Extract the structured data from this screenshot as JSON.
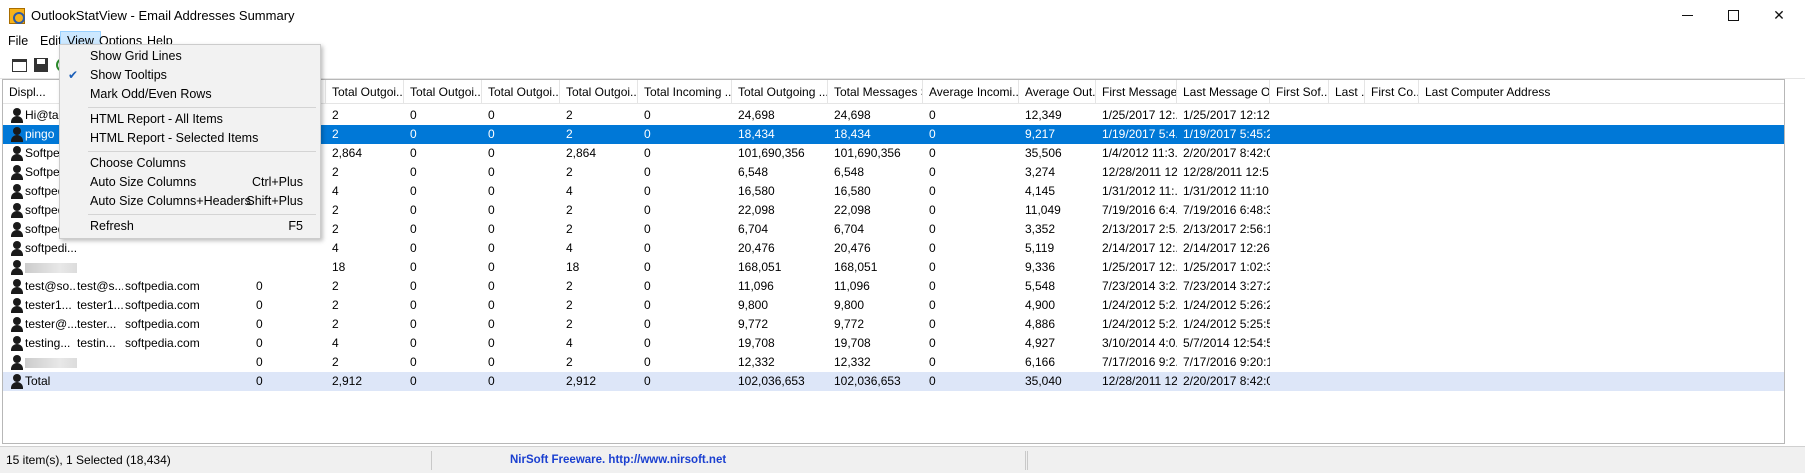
{
  "window": {
    "app_name": "OutlookStatView",
    "title_separator": "-",
    "subtitle": "Email Addresses Summary",
    "minimize": "—",
    "maximize": "□",
    "close": "✕"
  },
  "menu": {
    "file": "File",
    "edit": "Edit",
    "view": "View",
    "options": "Options",
    "help": "Help"
  },
  "view_menu": {
    "show_grid_lines": "Show Grid Lines",
    "show_tooltips": "Show Tooltips",
    "show_tooltips_checked": true,
    "mark_odd_even": "Mark Odd/Even Rows",
    "html_all": "HTML Report - All Items",
    "html_selected": "HTML Report - Selected Items",
    "choose_columns": "Choose Columns",
    "auto_size_columns": "Auto Size Columns",
    "auto_size_columns_shortcut": "Ctrl+Plus",
    "auto_size_headers": "Auto Size Columns+Headers",
    "auto_size_headers_shortcut": "Shift+Plus",
    "refresh": "Refresh",
    "refresh_shortcut": "F5"
  },
  "columns": [
    "Displ...",
    "Total Outgoi...",
    "Total Outgoi...",
    "Total Outgoi...",
    "Total Outgoi...",
    "Total Incoming ...",
    "Total Outgoing ...",
    "Total Messages S...",
    "Average Incomi...",
    "Average Out...",
    "First Message...",
    "Last Message On",
    "First Sof...",
    "Last ...",
    "First Co...",
    "Last Computer Address"
  ],
  "rows": [
    {
      "name": "Hi@tag...",
      "c2": "",
      "c3": "",
      "c4": "",
      "v": [
        "2",
        "0",
        "0",
        "2",
        "0",
        "24,698",
        "24,698",
        "0",
        "12,349",
        "1/25/2017 12:...",
        "1/25/2017 12:12:..."
      ]
    },
    {
      "name": "pingo",
      "c2": "",
      "c3": "",
      "c4": "",
      "v": [
        "2",
        "0",
        "0",
        "2",
        "0",
        "18,434",
        "18,434",
        "0",
        "9,217",
        "1/19/2017 5:4...",
        "1/19/2017 5:45:2..."
      ]
    },
    {
      "name": "Softpedi...",
      "c2": "",
      "c3": "",
      "c4": "",
      "v": [
        "2,864",
        "0",
        "0",
        "2,864",
        "0",
        "101,690,356",
        "101,690,356",
        "0",
        "35,506",
        "1/4/2012 11:3...",
        "2/20/2017 8:42:0..."
      ]
    },
    {
      "name": "Softpedi...",
      "c2": "",
      "c3": "",
      "c4": "",
      "v": [
        "2",
        "0",
        "0",
        "2",
        "0",
        "6,548",
        "6,548",
        "0",
        "3,274",
        "12/28/2011 12...",
        "12/28/2011 12:5..."
      ]
    },
    {
      "name": "softpedi...",
      "c2": "",
      "c3": "",
      "c4": "",
      "v": [
        "4",
        "0",
        "0",
        "4",
        "0",
        "16,580",
        "16,580",
        "0",
        "4,145",
        "1/31/2012 11:...",
        "1/31/2012 11:10:..."
      ]
    },
    {
      "name": "softpedi...",
      "c2": "",
      "c3": "",
      "c4": "",
      "v": [
        "2",
        "0",
        "0",
        "2",
        "0",
        "22,098",
        "22,098",
        "0",
        "11,049",
        "7/19/2016 6:4...",
        "7/19/2016 6:48:3..."
      ]
    },
    {
      "name": "softpedi...",
      "c2": "",
      "c3": "",
      "c4": "",
      "v": [
        "2",
        "0",
        "0",
        "2",
        "0",
        "6,704",
        "6,704",
        "0",
        "3,352",
        "2/13/2017 2:5...",
        "2/13/2017 2:56:1..."
      ]
    },
    {
      "name": "softpedi...",
      "c2": "",
      "c3": "",
      "c4": "",
      "v": [
        "4",
        "0",
        "0",
        "4",
        "0",
        "20,476",
        "20,476",
        "0",
        "5,119",
        "2/14/2017 12:...",
        "2/14/2017 12:26:..."
      ]
    },
    {
      "name": "",
      "blurred": true,
      "c2": "",
      "c3": "",
      "c4": "",
      "v": [
        "18",
        "0",
        "0",
        "18",
        "0",
        "168,051",
        "168,051",
        "0",
        "9,336",
        "1/25/2017 12:...",
        "1/25/2017 1:02:3..."
      ]
    },
    {
      "name": "test@so...",
      "c2": "test@s...",
      "c3": "softpedia.com",
      "c4": "0",
      "v": [
        "2",
        "0",
        "0",
        "2",
        "0",
        "11,096",
        "11,096",
        "0",
        "5,548",
        "7/23/2014 3:2...",
        "7/23/2014 3:27:2..."
      ]
    },
    {
      "name": "tester1...",
      "c2": "tester1...",
      "c3": "softpedia.com",
      "c4": "0",
      "v": [
        "2",
        "0",
        "0",
        "2",
        "0",
        "9,800",
        "9,800",
        "0",
        "4,900",
        "1/24/2012 5:2...",
        "1/24/2012 5:26:2..."
      ]
    },
    {
      "name": "tester@...",
      "c2": "tester...",
      "c3": "softpedia.com",
      "c4": "0",
      "v": [
        "2",
        "0",
        "0",
        "2",
        "0",
        "9,772",
        "9,772",
        "0",
        "4,886",
        "1/24/2012 5:2...",
        "1/24/2012 5:25:5..."
      ]
    },
    {
      "name": "testing...",
      "c2": "testin...",
      "c3": "softpedia.com",
      "c4": "0",
      "v": [
        "4",
        "0",
        "0",
        "4",
        "0",
        "19,708",
        "19,708",
        "0",
        "4,927",
        "3/10/2014 4:0...",
        "5/7/2014 12:54:5..."
      ]
    },
    {
      "name": "",
      "blurred": true,
      "c2": "",
      "c3": "",
      "c4": "0",
      "v": [
        "2",
        "0",
        "0",
        "2",
        "0",
        "12,332",
        "12,332",
        "0",
        "6,166",
        "7/17/2016 9:2...",
        "7/17/2016 9:20:1..."
      ]
    },
    {
      "name": "Total",
      "c2": "",
      "c3": "",
      "c4": "0",
      "v": [
        "2,912",
        "0",
        "0",
        "2,912",
        "0",
        "102,036,653",
        "102,036,653",
        "0",
        "35,040",
        "12/28/2011 12...",
        "2/20/2017 8:42:0..."
      ]
    }
  ],
  "status": {
    "items": "15 item(s), 1 Selected (18,434)",
    "credit": "NirSoft Freeware.  http://www.nirsoft.net"
  }
}
